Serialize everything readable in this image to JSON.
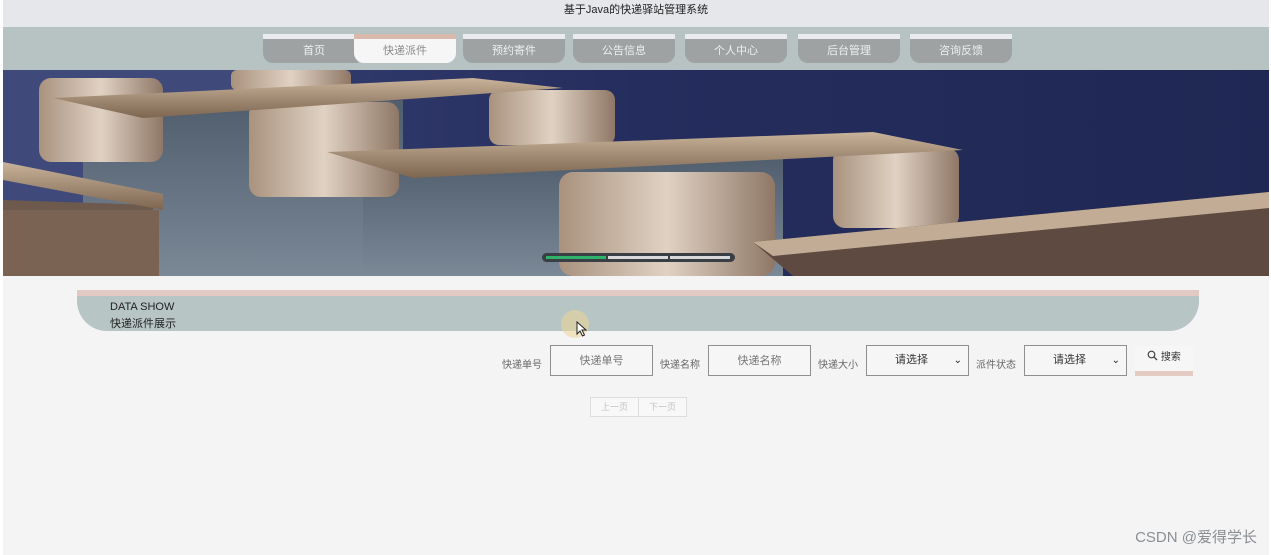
{
  "site": {
    "title": "基于Java的快递驿站管理系统"
  },
  "nav": {
    "items": [
      {
        "label": "首页",
        "active": false
      },
      {
        "label": "快递派件",
        "active": true
      },
      {
        "label": "预约寄件",
        "active": false
      },
      {
        "label": "公告信息",
        "active": false
      },
      {
        "label": "个人中心",
        "active": false
      },
      {
        "label": "后台管理",
        "active": false
      },
      {
        "label": "咨询反馈",
        "active": false
      }
    ]
  },
  "banner": {
    "indicators": 3,
    "active_index": 0
  },
  "section": {
    "title_en": "DATA SHOW",
    "title_cn": "快递派件展示"
  },
  "search": {
    "number_label": "快递单号",
    "number_placeholder": "快递单号",
    "name_label": "快递名称",
    "name_placeholder": "快递名称",
    "size_label": "快递大小",
    "size_value": "请选择",
    "status_label": "派件状态",
    "status_value": "请选择",
    "button_label": "搜索",
    "button_icon": "search-icon"
  },
  "pagination": {
    "prev_label": "上一页",
    "next_label": "下一页"
  },
  "watermark": "CSDN @爱得学长",
  "colors": {
    "nav_bg": "#b6c3c2",
    "nav_item": "#9ea2a2",
    "accent": "#d9b9ac",
    "indicator_active": "#2fb36b"
  }
}
